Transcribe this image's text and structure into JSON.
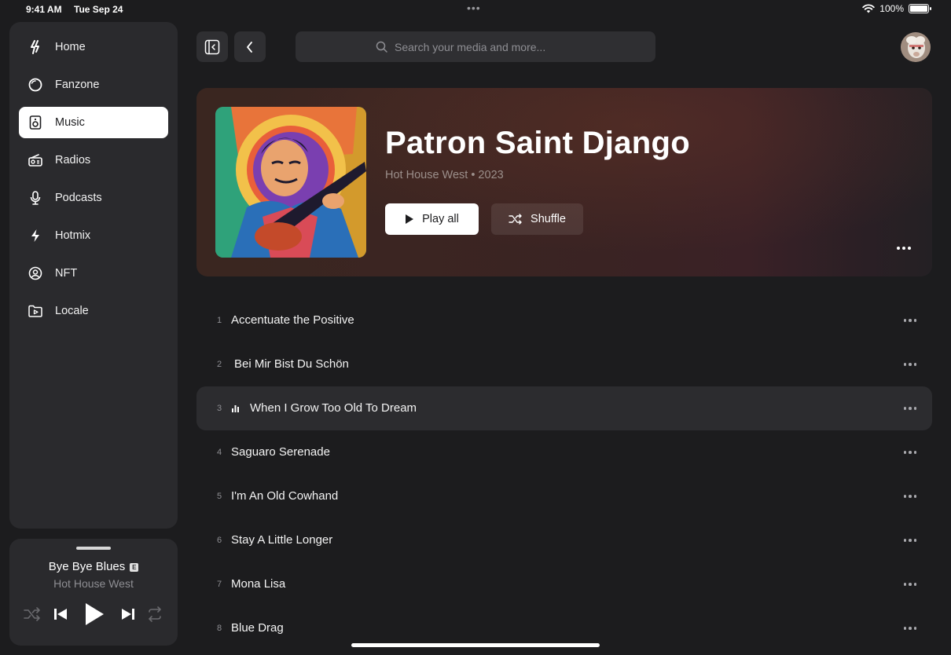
{
  "status_bar": {
    "time": "9:41 AM",
    "date": "Tue Sep 24",
    "battery": "100%"
  },
  "sidebar": {
    "items": [
      {
        "label": "Home",
        "icon": "bolt-icon"
      },
      {
        "label": "Fanzone",
        "icon": "circle-icon"
      },
      {
        "label": "Music",
        "icon": "speaker-icon",
        "active": true
      },
      {
        "label": "Radios",
        "icon": "radio-icon"
      },
      {
        "label": "Podcasts",
        "icon": "microphone-icon"
      },
      {
        "label": "Hotmix",
        "icon": "lightning-icon"
      },
      {
        "label": "NFT",
        "icon": "user-circle-icon"
      },
      {
        "label": "Locale",
        "icon": "folder-play-icon"
      }
    ]
  },
  "search": {
    "placeholder": "Search your media and more..."
  },
  "album": {
    "title": "Patron Saint Django",
    "meta": "Hot House West • 2023",
    "play_label": "Play all",
    "shuffle_label": "Shuffle"
  },
  "tracks": [
    {
      "number": "1",
      "title": "Accentuate the Positive"
    },
    {
      "number": "2",
      "title": "Bei Mir Bist Du Schön"
    },
    {
      "number": "3",
      "title": "When I Grow Too Old To Dream",
      "playing": true
    },
    {
      "number": "4",
      "title": "Saguaro Serenade"
    },
    {
      "number": "5",
      "title": "I'm An Old Cowhand"
    },
    {
      "number": "6",
      "title": "Stay A Little Longer"
    },
    {
      "number": "7",
      "title": "Mona Lisa"
    },
    {
      "number": "8",
      "title": "Blue Drag"
    }
  ],
  "now_playing": {
    "title": "Bye Bye Blues",
    "explicit_badge": "E",
    "artist": "Hot House West"
  },
  "colors": {
    "background": "#1c1c1e",
    "panel": "#2a2a2d",
    "accent": "#ffffff"
  }
}
